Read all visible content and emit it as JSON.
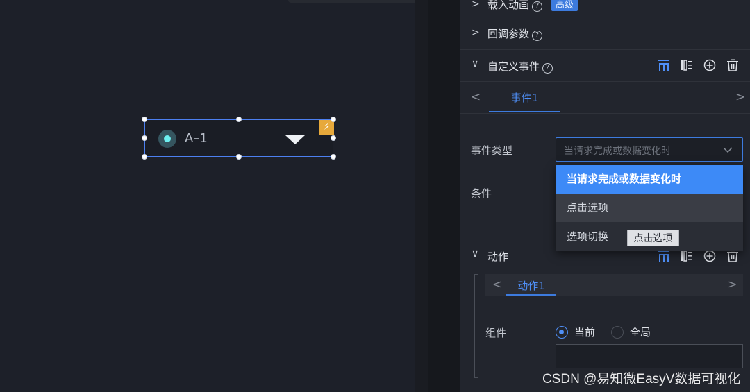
{
  "canvas": {
    "widget": {
      "label": "A–1",
      "bolt": "⚡"
    }
  },
  "panel": {
    "sections": {
      "load_anim": {
        "caret": ">",
        "title": "载入动画",
        "badge": "高级"
      },
      "callback": {
        "caret": ">",
        "title": "回调参数"
      },
      "custom_event": {
        "caret": "∨",
        "title": "自定义事件"
      },
      "action": {
        "caret": "∨",
        "title": "动作"
      }
    },
    "event_tabs": {
      "prev": "<",
      "next": ">",
      "active": "事件1"
    },
    "event_type": {
      "label": "事件类型",
      "placeholder": "当请求完成或数据变化时",
      "options": [
        "当请求完成或数据变化时",
        "点击选项",
        "选项切换"
      ],
      "tooltip": "点击选项"
    },
    "condition": {
      "label": "条件"
    },
    "action_tabs": {
      "prev": "<",
      "next": ">",
      "active": "动作1"
    },
    "component": {
      "label": "组件",
      "options": [
        "当前",
        "全局"
      ],
      "selected": "当前"
    }
  },
  "watermark": "CSDN @易知微EasyV数据可视化",
  "colors": {
    "accent": "#3d7bde",
    "highlight": "#3d8af7",
    "bolt": "#e7a93b",
    "dot": "#6ef0f0"
  },
  "icons": [
    "help-circle-icon",
    "align-top-icon",
    "list-icon",
    "plus-circle-icon",
    "trash-icon",
    "chevron-down-icon",
    "bolt-icon"
  ]
}
